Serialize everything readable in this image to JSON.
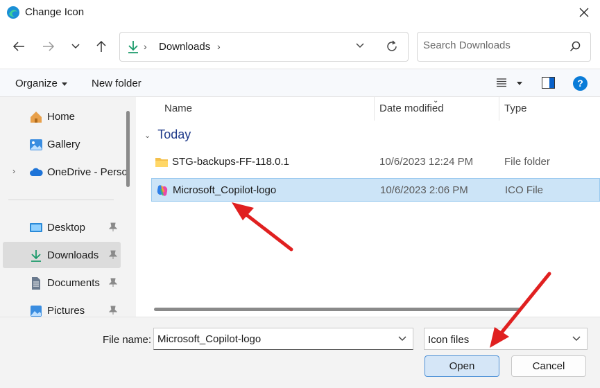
{
  "window": {
    "title": "Change Icon"
  },
  "nav": {
    "address_folder": "Downloads",
    "search_placeholder": "Search Downloads"
  },
  "toolbar": {
    "organize_label": "Organize",
    "new_folder_label": "New folder"
  },
  "sidebar": {
    "items": [
      {
        "label": "Home",
        "icon": "home-icon"
      },
      {
        "label": "Gallery",
        "icon": "gallery-icon"
      },
      {
        "label": "OneDrive - Perso",
        "icon": "cloud-icon"
      },
      {
        "label": "Desktop",
        "icon": "desktop-icon",
        "pinned": true
      },
      {
        "label": "Downloads",
        "icon": "download-icon",
        "pinned": true,
        "selected": true
      },
      {
        "label": "Documents",
        "icon": "document-icon",
        "pinned": true
      },
      {
        "label": "Pictures",
        "icon": "pictures-icon",
        "pinned": true
      }
    ]
  },
  "file_list": {
    "columns": [
      "Name",
      "Date modified",
      "Type"
    ],
    "group": "Today",
    "rows": [
      {
        "name": "STG-backups-FF-118.0.1",
        "date": "10/6/2023 12:24 PM",
        "type": "File folder",
        "icon": "folder-icon"
      },
      {
        "name": "Microsoft_Copilot-logo",
        "date": "10/6/2023 2:06 PM",
        "type": "ICO File",
        "icon": "copilot-icon",
        "selected": true
      }
    ]
  },
  "footer": {
    "filename_label": "File name:",
    "filename_value": "Microsoft_Copilot-logo",
    "filetype_value": "Icon files",
    "open_label": "Open",
    "cancel_label": "Cancel"
  },
  "colors": {
    "accent": "#0a62c9",
    "selection": "#cce4f7",
    "annotation_arrow": "#e02020"
  }
}
